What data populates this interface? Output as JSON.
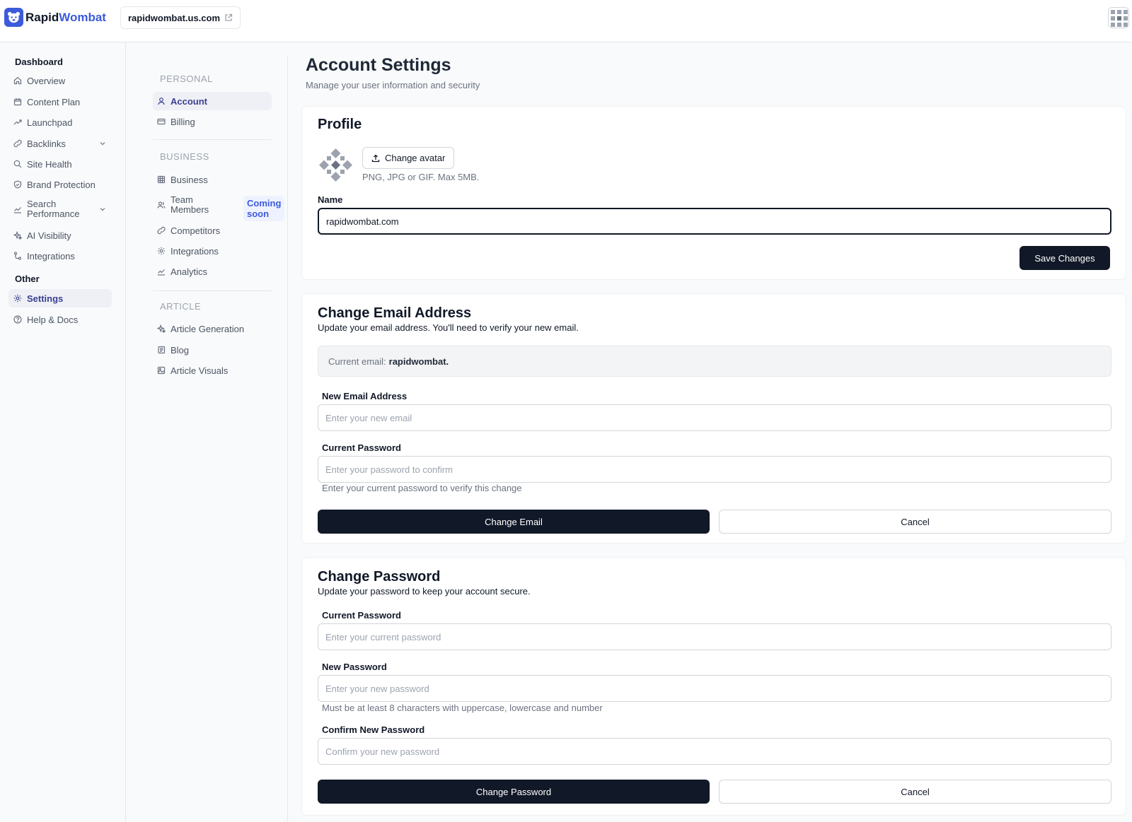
{
  "brand": {
    "name_part1": "Rapid",
    "name_part2": "Wombat"
  },
  "header": {
    "site_domain": "rapidwombat.us.com"
  },
  "sidebar": {
    "section_dashboard": "Dashboard",
    "items": [
      {
        "label": "Overview"
      },
      {
        "label": "Content Plan"
      },
      {
        "label": "Launchpad"
      },
      {
        "label": "Backlinks"
      },
      {
        "label": "Site Health"
      },
      {
        "label": "Brand Protection"
      },
      {
        "label_line1": "Search",
        "label_line2": "Performance"
      },
      {
        "label": "AI Visibility"
      },
      {
        "label": "Integrations"
      }
    ],
    "section_other": "Other",
    "other_items": [
      {
        "label": "Settings"
      },
      {
        "label": "Help & Docs"
      }
    ]
  },
  "subnav": {
    "personal_heading": "PERSONAL",
    "personal": [
      {
        "label": "Account"
      },
      {
        "label": "Billing"
      }
    ],
    "business_heading": "BUSINESS",
    "business": [
      {
        "label": "Business"
      },
      {
        "label_line1": "Team",
        "label_line2": "Members",
        "badge": "Coming soon"
      },
      {
        "label": "Competitors"
      },
      {
        "label": "Integrations"
      },
      {
        "label": "Analytics"
      }
    ],
    "article_heading": "ARTICLE",
    "article": [
      {
        "label": "Article Generation"
      },
      {
        "label": "Blog"
      },
      {
        "label": "Article Visuals"
      }
    ]
  },
  "main": {
    "title": "Account Settings",
    "subtitle": "Manage your user information and security"
  },
  "profile": {
    "title": "Profile",
    "change_avatar_label": "Change avatar",
    "avatar_hint": "PNG, JPG or GIF. Max 5MB.",
    "name_label": "Name",
    "name_value": "rapidwombat.com",
    "save_label": "Save Changes"
  },
  "email_card": {
    "title": "Change Email Address",
    "description": "Update your email address. You'll need to verify your new email.",
    "current_email_prefix": "Current email:",
    "current_email_value": "rapidwombat.",
    "new_email_label": "New Email Address",
    "new_email_placeholder": "Enter your new email",
    "password_label": "Current Password",
    "password_placeholder": "Enter your password to confirm",
    "password_hint": "Enter your current password to verify this change",
    "submit_label": "Change Email",
    "cancel_label": "Cancel"
  },
  "password_card": {
    "title": "Change Password",
    "description": "Update your password to keep your account secure.",
    "current_label": "Current Password",
    "current_placeholder": "Enter your current password",
    "new_label": "New Password",
    "new_placeholder": "Enter your new password",
    "new_hint": "Must be at least 8 characters with uppercase, lowercase and number",
    "confirm_label": "Confirm New Password",
    "confirm_placeholder": "Confirm your new password",
    "submit_label": "Change Password",
    "cancel_label": "Cancel"
  },
  "colors": {
    "accent": "#3b5bdb",
    "primary_button": "#111827",
    "active_nav_bg": "#eef0f6"
  }
}
